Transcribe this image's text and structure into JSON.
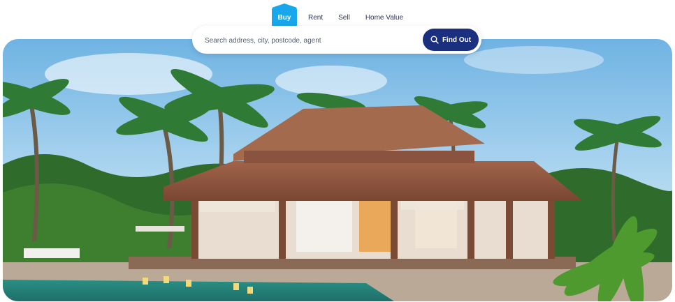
{
  "tabs": [
    {
      "label": "Buy",
      "active": true
    },
    {
      "label": "Rent",
      "active": false
    },
    {
      "label": "Sell",
      "active": false
    },
    {
      "label": "Home Value",
      "active": false
    }
  ],
  "search": {
    "placeholder": "Search address, city, postcode, agent",
    "value": "",
    "button_label": "Find Out",
    "button_icon": "search-icon"
  },
  "hero": {
    "image": "tropical-villa-with-pool-and-palm-trees"
  },
  "colors": {
    "accent": "#17a7ea",
    "brand": "#1b2f7f",
    "tab_text": "#2b3357"
  }
}
